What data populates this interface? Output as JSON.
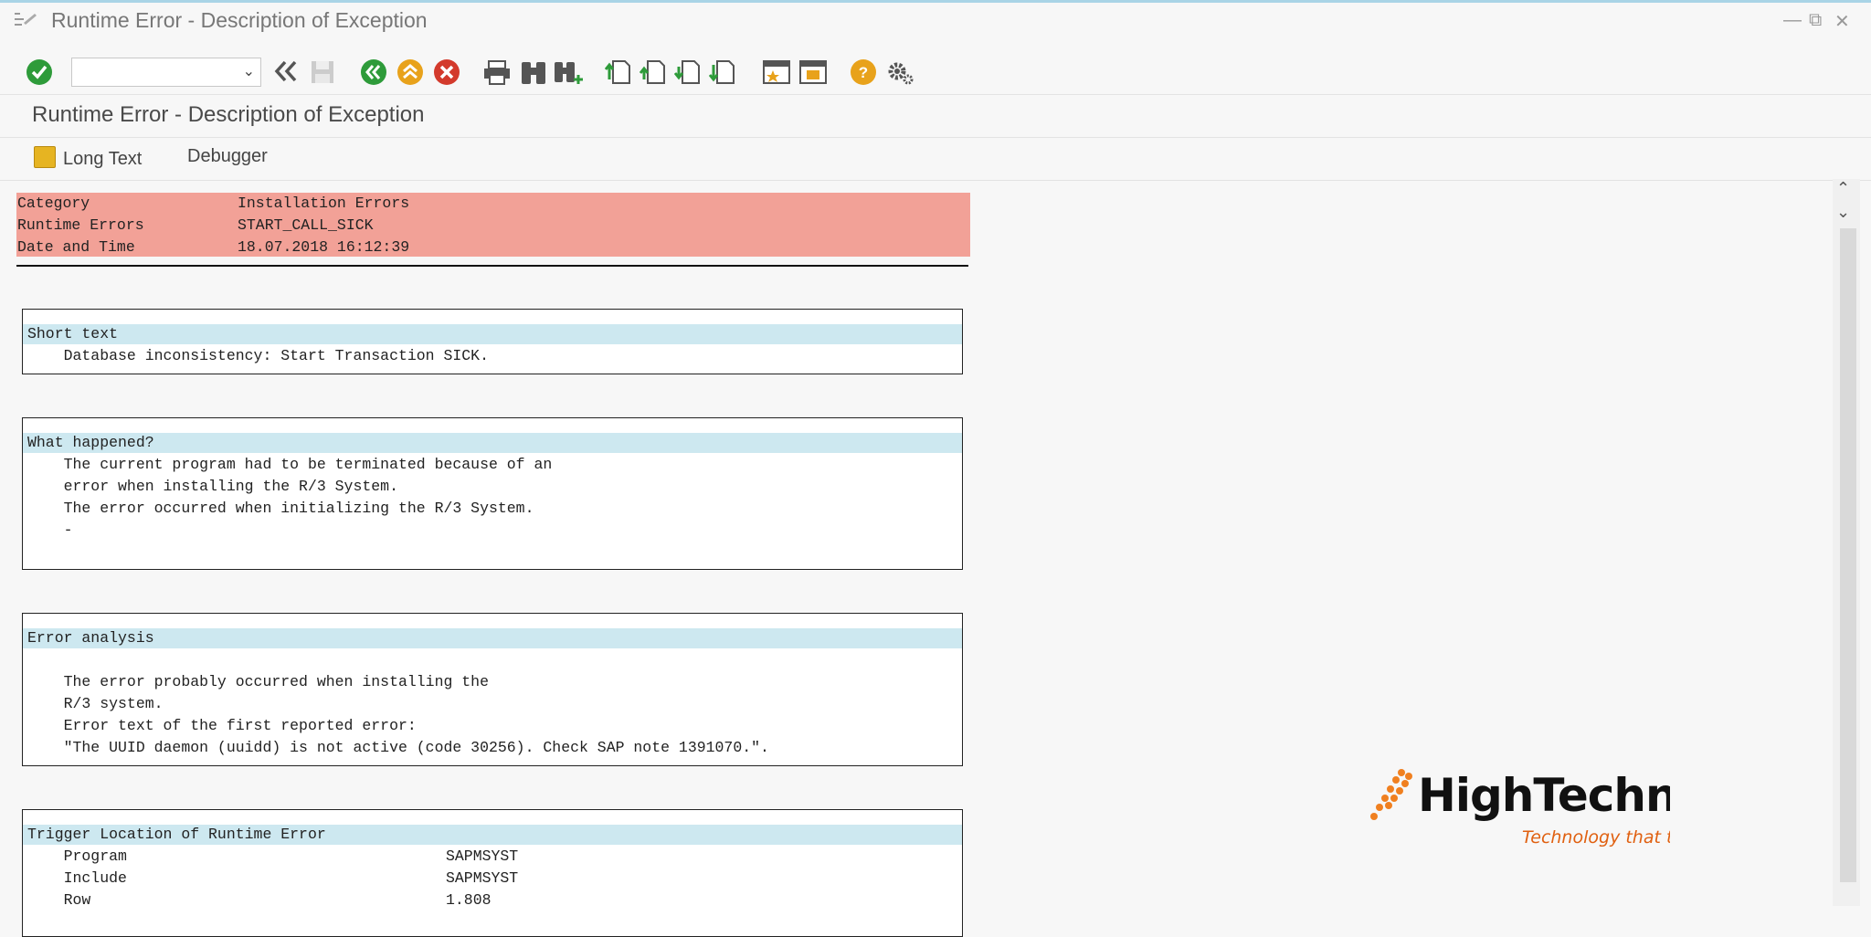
{
  "window": {
    "title": "Runtime Error - Description of Exception",
    "controls": [
      "minimize",
      "restore",
      "close"
    ]
  },
  "toolbar": {
    "command_field_value": "",
    "icons": [
      "enter-icon",
      "back-double-icon",
      "save-icon",
      "back-icon",
      "exit-icon",
      "cancel-icon",
      "print-icon",
      "find-icon",
      "find-next-icon",
      "first-page-icon",
      "previous-page-icon",
      "next-page-icon",
      "last-page-icon",
      "create-session-icon",
      "shortcut-icon",
      "help-icon",
      "settings-icon"
    ],
    "colors": {
      "green": "#2e9b3a",
      "orange": "#e8a21b",
      "red": "#d33a2c",
      "help": "#e8a21b"
    }
  },
  "screen": {
    "title": "Runtime Error - Description of Exception",
    "app_buttons": {
      "long_text": "Long Text",
      "debugger": "Debugger"
    }
  },
  "header": {
    "rows": [
      {
        "label": "Category",
        "value": "Installation Errors"
      },
      {
        "label": "Runtime Errors",
        "value": "START_CALL_SICK"
      },
      {
        "label": "Date and Time",
        "value": "18.07.2018 16:12:39"
      }
    ],
    "color": "#f2a197"
  },
  "sections": {
    "short_text": {
      "title": "Short text",
      "lines": [
        "    Database inconsistency: Start Transaction SICK."
      ]
    },
    "what_happened": {
      "title": "What happened?",
      "lines": [
        "    The current program had to be terminated because of an",
        "    error when installing the R/3 System.",
        "    The error occurred when initializing the R/3 System.",
        "    -"
      ]
    },
    "error_analysis": {
      "title": "Error analysis",
      "lines": [
        "",
        "    The error probably occurred when installing the",
        "    R/3 system.",
        "    Error text of the first reported error:",
        "    \"The UUID daemon (uuidd) is not active (code 30256). Check SAP note 1391070.\"."
      ]
    },
    "trigger_location": {
      "title": "Trigger Location of Runtime Error",
      "rows": [
        {
          "label": "    Program",
          "value": "SAPMSYST"
        },
        {
          "label": "    Include",
          "value": "SAPMSYST"
        },
        {
          "label": "    Row",
          "value": "1.808"
        }
      ]
    }
  },
  "watermark": {
    "word": "HighTechnolo",
    "tagline": "Technology that te"
  }
}
